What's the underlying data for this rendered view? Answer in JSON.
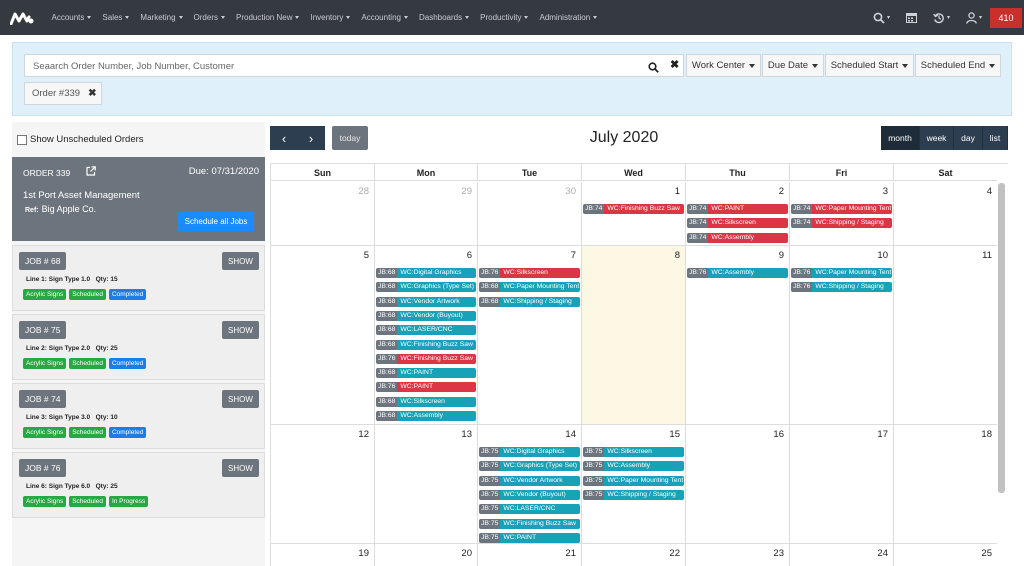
{
  "topbar": {
    "menu": [
      "Accounts",
      "Sales",
      "Marketing",
      "Orders",
      "Production New",
      "Inventory",
      "Accounting",
      "Dashboards",
      "Productivity",
      "Administration"
    ],
    "badge": "410"
  },
  "search": {
    "placeholder": "Seaarch Order Number, Job Number, Customer",
    "buttons": [
      "Work Center",
      "Due Date",
      "Scheduled Start",
      "Scheduled End"
    ],
    "filter_chip": "Order #339"
  },
  "sidebar": {
    "show_unscheduled": "Show Unscheduled Orders",
    "order": {
      "title": "ORDER 339",
      "due": "Due: 07/31/2020",
      "customer": "1st Port Asset Management",
      "ref_label": "Ref:",
      "ref": "Big Apple Co.",
      "schedule_all": "Schedule all Jobs"
    },
    "jobs": [
      {
        "job": "JOB # 68",
        "show": "SHOW",
        "line": "Line 1: Sign Type 1.0",
        "qty": "Qty: 15",
        "tags": [
          "Acrylic Signs",
          "Scheduled",
          "Completed"
        ]
      },
      {
        "job": "JOB # 75",
        "show": "SHOW",
        "line": "Line 2: Sign Type 2.0",
        "qty": "Qty: 25",
        "tags": [
          "Acrylic Signs",
          "Scheduled",
          "Completed"
        ]
      },
      {
        "job": "JOB # 74",
        "show": "SHOW",
        "line": "Line 3: Sign Type 3.0",
        "qty": "Qty: 10",
        "tags": [
          "Acrylic Signs",
          "Scheduled",
          "Completed"
        ]
      },
      {
        "job": "JOB # 76",
        "show": "SHOW",
        "line": "Line 6: Sign Type 6.0",
        "qty": "Qty: 25",
        "tags": [
          "Acrylic Signs",
          "Scheduled",
          "In Progress"
        ]
      }
    ]
  },
  "calendar": {
    "title": "July 2020",
    "today": "today",
    "views": [
      "month",
      "week",
      "day",
      "list"
    ],
    "active_view": "month",
    "prev": "‹",
    "next": "›",
    "weekdays": [
      "Sun",
      "Mon",
      "Tue",
      "Wed",
      "Thu",
      "Fri",
      "Sat"
    ],
    "weeks": [
      {
        "days": [
          {
            "n": "28",
            "other": true
          },
          {
            "n": "29",
            "other": true
          },
          {
            "n": "30",
            "other": true
          },
          {
            "n": "1"
          },
          {
            "n": "2"
          },
          {
            "n": "3"
          },
          {
            "n": "4"
          }
        ],
        "events": [
          {
            "day": 3,
            "jb": "JB:74",
            "wc": "WC:Finishing Buzz Saw",
            "color": "red"
          },
          {
            "day": 4,
            "jb": "JB:74",
            "wc": "WC:PAINT",
            "color": "red"
          },
          {
            "day": 4,
            "jb": "JB:74",
            "wc": "WC:Silkscreen",
            "color": "red"
          },
          {
            "day": 4,
            "jb": "JB:74",
            "wc": "WC:Assembly",
            "color": "red"
          },
          {
            "day": 5,
            "jb": "JB:74",
            "wc": "WC:Paper Mounting Tent",
            "color": "red"
          },
          {
            "day": 5,
            "jb": "JB:74",
            "wc": "WC:Shipping / Staging",
            "color": "red"
          }
        ]
      },
      {
        "days": [
          {
            "n": "5"
          },
          {
            "n": "6"
          },
          {
            "n": "7"
          },
          {
            "n": "8",
            "today": true
          },
          {
            "n": "9"
          },
          {
            "n": "10"
          },
          {
            "n": "11"
          }
        ],
        "events": [
          {
            "day": 1,
            "jb": "JB:68",
            "wc": "WC:Digital Graphics",
            "color": "teal"
          },
          {
            "day": 1,
            "jb": "JB:68",
            "wc": "WC:Graphics (Type Set)",
            "color": "teal"
          },
          {
            "day": 1,
            "jb": "JB:68",
            "wc": "WC:Vendor Artwork",
            "color": "teal"
          },
          {
            "day": 1,
            "jb": "JB:68",
            "wc": "WC:Vendor (Buyout)",
            "color": "teal"
          },
          {
            "day": 1,
            "jb": "JB:68",
            "wc": "WC:LASER/CNC",
            "color": "teal"
          },
          {
            "day": 1,
            "jb": "JB:68",
            "wc": "WC:Finishing Buzz Saw",
            "color": "teal"
          },
          {
            "day": 1,
            "jb": "JB:76",
            "wc": "WC:Finishing Buzz Saw",
            "color": "red"
          },
          {
            "day": 1,
            "jb": "JB:68",
            "wc": "WC:PAINT",
            "color": "teal"
          },
          {
            "day": 1,
            "jb": "JB:76",
            "wc": "WC:PAINT",
            "color": "red"
          },
          {
            "day": 1,
            "jb": "JB:68",
            "wc": "WC:Silkscreen",
            "color": "teal"
          },
          {
            "day": 1,
            "jb": "JB:68",
            "wc": "WC:Assembly",
            "color": "teal"
          },
          {
            "day": 2,
            "jb": "JB:76",
            "wc": "WC:Silkscreen",
            "color": "red"
          },
          {
            "day": 2,
            "jb": "JB:68",
            "wc": "WC:Paper Mounting Tent",
            "color": "teal"
          },
          {
            "day": 2,
            "jb": "JB:68",
            "wc": "WC:Shipping / Staging",
            "color": "teal"
          },
          {
            "day": 4,
            "jb": "JB:76",
            "wc": "WC:Assembly",
            "color": "teal"
          },
          {
            "day": 5,
            "jb": "JB:76",
            "wc": "WC:Paper Mounting Tent",
            "color": "teal"
          },
          {
            "day": 5,
            "jb": "JB:76",
            "wc": "WC:Shipping / Staging",
            "color": "teal"
          }
        ]
      },
      {
        "days": [
          {
            "n": "12"
          },
          {
            "n": "13"
          },
          {
            "n": "14"
          },
          {
            "n": "15"
          },
          {
            "n": "16"
          },
          {
            "n": "17"
          },
          {
            "n": "18"
          }
        ],
        "events": [
          {
            "day": 2,
            "jb": "JB:75",
            "wc": "WC:Digital Graphics",
            "color": "teal"
          },
          {
            "day": 2,
            "jb": "JB:75",
            "wc": "WC:Graphics (Type Set)",
            "color": "teal"
          },
          {
            "day": 2,
            "jb": "JB:75",
            "wc": "WC:Vendor Artwork",
            "color": "teal"
          },
          {
            "day": 2,
            "jb": "JB:75",
            "wc": "WC:Vendor (Buyout)",
            "color": "teal"
          },
          {
            "day": 2,
            "jb": "JB:75",
            "wc": "WC:LASER/CNC",
            "color": "teal"
          },
          {
            "day": 2,
            "jb": "JB:75",
            "wc": "WC:Finishing Buzz Saw",
            "color": "teal"
          },
          {
            "day": 2,
            "jb": "JB:75",
            "wc": "WC:PAINT",
            "color": "teal"
          },
          {
            "day": 3,
            "jb": "JB:75",
            "wc": "WC:Silkscreen",
            "color": "teal"
          },
          {
            "day": 3,
            "jb": "JB:75",
            "wc": "WC:Assembly",
            "color": "teal"
          },
          {
            "day": 3,
            "jb": "JB:75",
            "wc": "WC:Paper Mounting Tent",
            "color": "teal"
          },
          {
            "day": 3,
            "jb": "JB:75",
            "wc": "WC:Shipping / Staging",
            "color": "teal"
          }
        ]
      },
      {
        "days": [
          {
            "n": "19"
          },
          {
            "n": "20"
          },
          {
            "n": "21"
          },
          {
            "n": "22"
          },
          {
            "n": "23"
          },
          {
            "n": "24"
          },
          {
            "n": "25"
          }
        ],
        "events": []
      }
    ]
  }
}
